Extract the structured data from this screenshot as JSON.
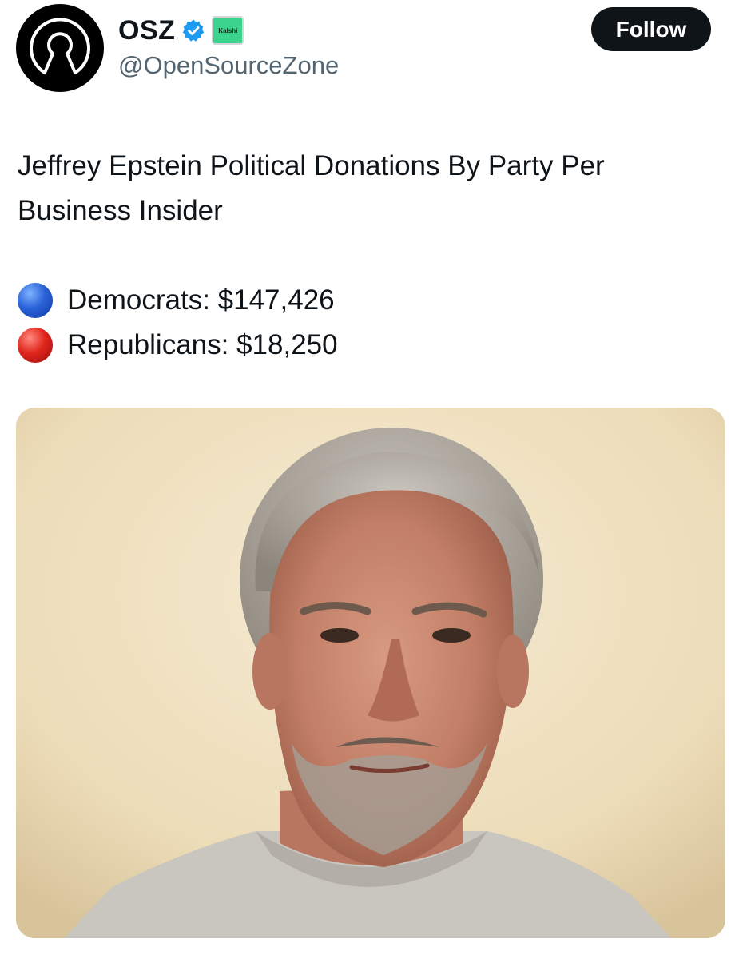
{
  "author": {
    "display_name": "OSZ",
    "handle": "@OpenSourceZone",
    "verified_icon": "verified-badge-icon",
    "affiliate_badge_label": "Kalshi",
    "avatar_icon": "open-source-keyhole-logo",
    "colors": {
      "verified_blue": "#1d9bf0",
      "affiliate_green": "#3ad48f"
    }
  },
  "actions": {
    "follow_label": "Follow"
  },
  "tweet": {
    "lines": [
      "Jeffrey Epstein Political Donations By Party Per",
      "Business Insider"
    ],
    "parties": [
      {
        "icon": "blue-circle-emoji",
        "text": "Democrats: $147,426",
        "color": "#2a63d8"
      },
      {
        "icon": "red-circle-emoji",
        "text": "Republicans: $18,250",
        "color": "#e0261d"
      }
    ]
  },
  "media": {
    "type": "photo",
    "subject": "man-portrait-photo"
  }
}
